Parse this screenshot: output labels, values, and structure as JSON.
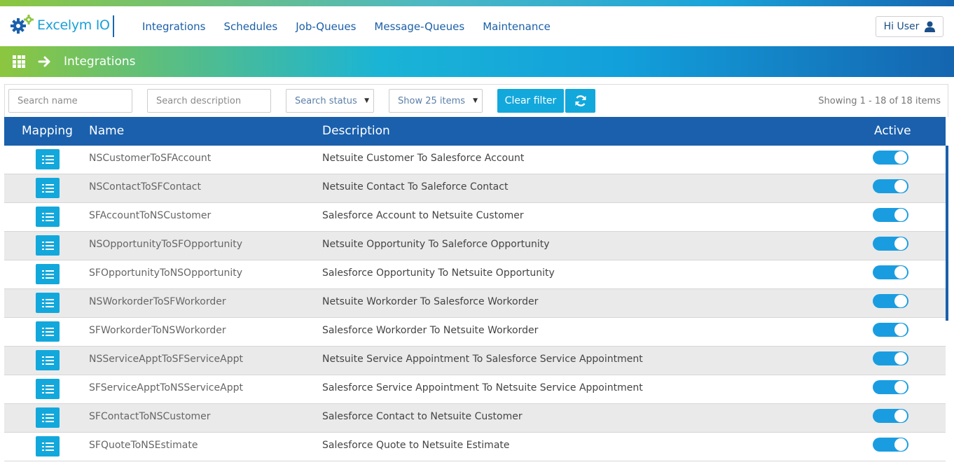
{
  "header": {
    "logo_text": "Excelym IO",
    "nav": [
      "Integrations",
      "Schedules",
      "Job-Queues",
      "Message-Queues",
      "Maintenance"
    ],
    "user_label": "Hi User"
  },
  "breadcrumb": {
    "title": "Integrations"
  },
  "filters": {
    "search_name_placeholder": "Search name",
    "search_description_placeholder": "Search description",
    "status_select": "Search status",
    "page_size_select": "Show 25 items",
    "clear_label": "Clear filter",
    "showing_text": "Showing 1 - 18 of 18 items"
  },
  "table": {
    "columns": {
      "mapping": "Mapping",
      "name": "Name",
      "description": "Description",
      "active": "Active"
    },
    "rows": [
      {
        "name": "NSCustomerToSFAccount",
        "description": "Netsuite Customer To Salesforce Account",
        "active": true
      },
      {
        "name": "NSContactToSFContact",
        "description": "Netsuite Contact To Saleforce Contact",
        "active": true
      },
      {
        "name": "SFAccountToNSCustomer",
        "description": "Salesforce Account to Netsuite Customer",
        "active": true
      },
      {
        "name": "NSOpportunityToSFOpportunity",
        "description": "Netsuite Opportunity To Saleforce Opportunity",
        "active": true
      },
      {
        "name": "SFOpportunityToNSOpportunity",
        "description": "Salesforce Opportunity To Netsuite Opportunity",
        "active": true
      },
      {
        "name": "NSWorkorderToSFWorkorder",
        "description": "Netsuite Workorder To Salesforce Workorder",
        "active": true
      },
      {
        "name": "SFWorkorderToNSWorkorder",
        "description": "Salesforce Workorder To Netsuite Workorder",
        "active": true
      },
      {
        "name": "NSServiceApptToSFServiceAppt",
        "description": "Netsuite Service Appointment To Salesforce Service Appointment",
        "active": true
      },
      {
        "name": "SFServiceApptToNSServiceAppt",
        "description": "Salesforce Service Appointment To Netsuite Service Appointment",
        "active": true
      },
      {
        "name": "SFContactToNSCustomer",
        "description": "Salesforce Contact to Netsuite Customer",
        "active": true
      },
      {
        "name": "SFQuoteToNSEstimate",
        "description": "Salesforce Quote to Netsuite Estimate",
        "active": true
      }
    ]
  },
  "colors": {
    "brand_blue": "#1a60ad",
    "accent": "#12a8dc",
    "toggle_on": "#1a9de0"
  }
}
